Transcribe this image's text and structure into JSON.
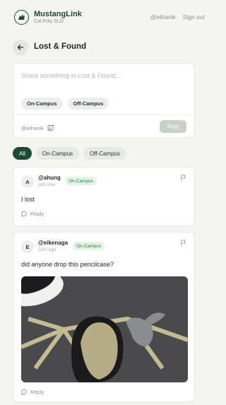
{
  "header": {
    "app_name": "MustangLink",
    "subtitle": "Cal Poly SLO",
    "username": "@ethanik",
    "sign_out": "Sign out"
  },
  "page": {
    "title": "Lost & Found"
  },
  "composer": {
    "placeholder": "Share something in Lost & Found...",
    "tags": [
      "On-Campus",
      "Off-Campus"
    ],
    "user": "@ethanik",
    "post_label": "Post"
  },
  "filters": {
    "items": [
      "All",
      "On-Campus",
      "Off-Campus"
    ],
    "selected": "All"
  },
  "posts": [
    {
      "avatar": "A",
      "username": "@ahung",
      "time": "just now",
      "badge": "On-Campus",
      "text": "I lost",
      "reply_label": "Reply"
    },
    {
      "avatar": "E",
      "username": "@eikenaga",
      "time": "32m ago",
      "badge": "On-Campus",
      "text": "did anyone drop this pencilcase?",
      "reply_label": "Reply",
      "image": "photo of a pencil case and a shoe on pavement"
    }
  ],
  "colors": {
    "brand": "#1c4a33",
    "badge_bg": "#e3f3e6",
    "badge_text": "#2d7a43",
    "background": "#f4f4f3"
  }
}
